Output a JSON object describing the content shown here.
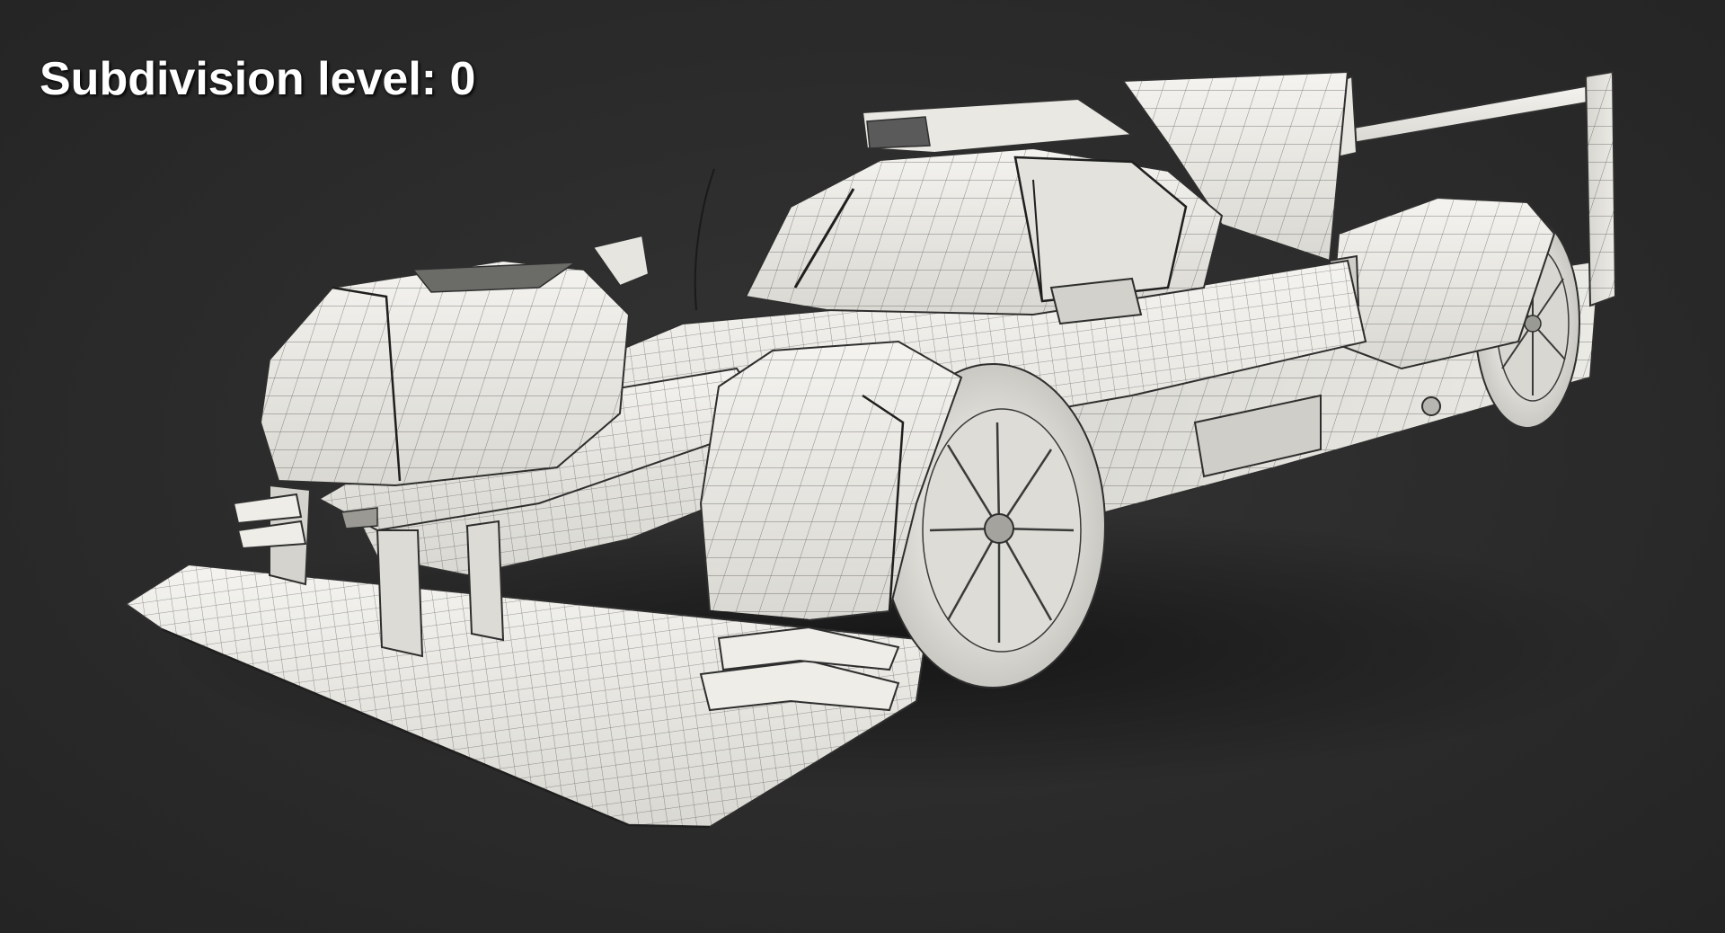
{
  "viewport": {
    "subdivision_label": "Subdivision level: 0",
    "background_color": "#2b2b2b",
    "model_fill_color": "#ecebe6",
    "wire_color": "#3a3a3a"
  },
  "model": {
    "subject": "LMP prototype race car wireframe",
    "render_style": "clay-with-wireframe"
  }
}
